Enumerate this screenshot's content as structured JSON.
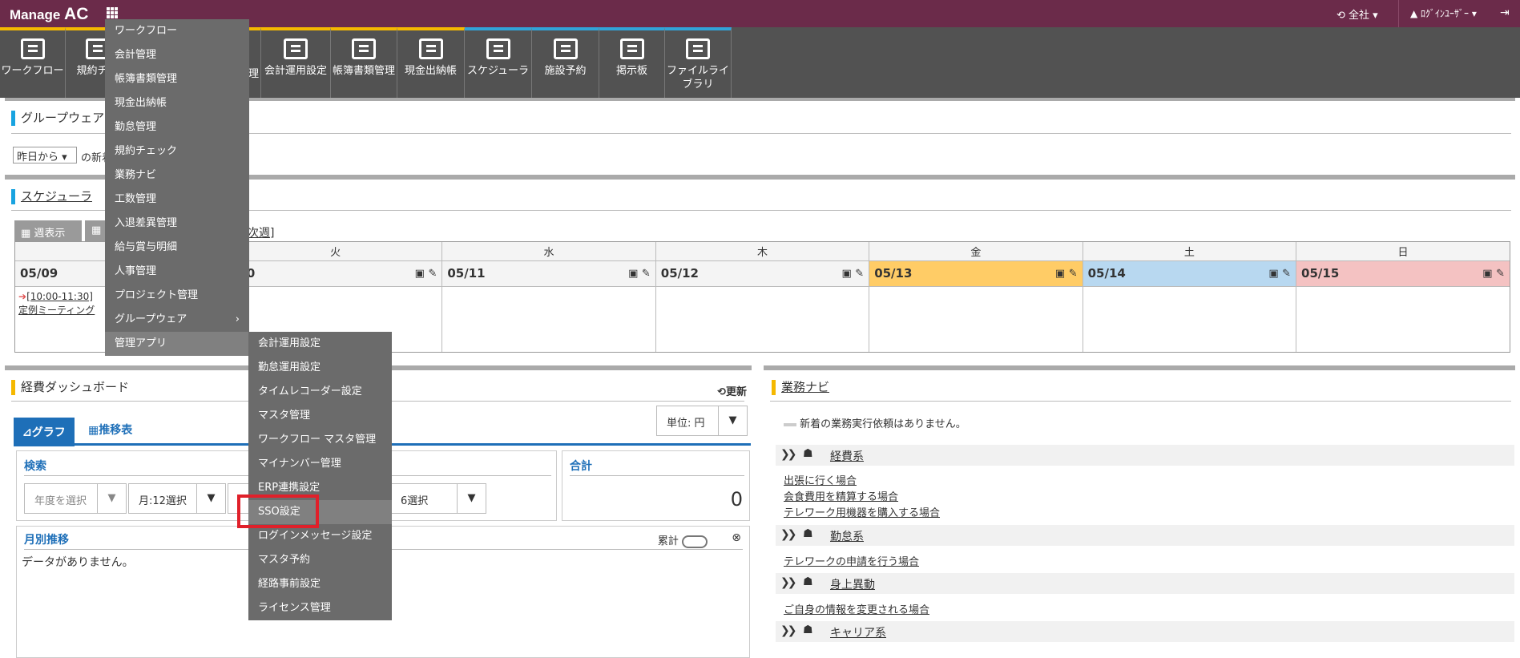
{
  "topbar": {
    "logo_prefix": "Manage",
    "logo_suffix": "AC",
    "scope": "全社",
    "user": "▲ ﾛｸﾞｲﾝﾕｰｻﾞｰ ▾"
  },
  "toolbar": [
    {
      "label": "ワークフロー"
    },
    {
      "label": "規約チェ"
    },
    {
      "label": ""
    },
    {
      "label": "理"
    },
    {
      "label": "会計運用設定"
    },
    {
      "label": "帳簿書類管理"
    },
    {
      "label": "現金出納帳"
    },
    {
      "label": "スケジューラ"
    },
    {
      "label": "施設予約"
    },
    {
      "label": "掲示板"
    },
    {
      "label": "ファイルライ\nブラリ"
    }
  ],
  "groupware": {
    "title": "グループウェア",
    "select": "昨日から",
    "suffix": "の新着"
  },
  "scheduler": {
    "title": "スケジューラ",
    "week_btn": "週表示",
    "next_week": "次週]",
    "days": [
      "",
      "火",
      "水",
      "木",
      "金",
      "土",
      "日"
    ],
    "dates": [
      "05/09",
      "/10",
      "05/11",
      "05/12",
      "05/13",
      "05/14",
      "05/15"
    ],
    "event_time": "[10:00-11:30]",
    "event_title": "定例ミーティング"
  },
  "dashboard": {
    "title": "経費ダッシュボード",
    "refresh": "更新",
    "tab_graph": "グラフ",
    "tab_table": "推移表",
    "unit": "単位: 円",
    "search": "検索",
    "year_placeholder": "年度を選択",
    "month_select": "月:12選択",
    "sel3": "6選択",
    "total_label": "合計",
    "total_value": "0",
    "monthly": "月別推移",
    "cumulative": "累計",
    "no_data": "データがありません。"
  },
  "gyomu": {
    "title": "業務ナビ",
    "no_requests": "新着の業務実行依頼はありません。",
    "cats": [
      {
        "name": "経費系",
        "links": [
          "出張に行く場合",
          "会食費用を精算する場合",
          "テレワーク用機器を購入する場合"
        ]
      },
      {
        "name": "勤怠系",
        "links": [
          "テレワークの申請を行う場合"
        ]
      },
      {
        "name": "身上異動",
        "links": [
          "ご自身の情報を変更される場合"
        ]
      },
      {
        "name": "キャリア系",
        "links": []
      }
    ]
  },
  "menu1": [
    "ワークフロー",
    "会計管理",
    "帳簿書類管理",
    "現金出納帳",
    "勤怠管理",
    "規約チェック",
    "業務ナビ",
    "工数管理",
    "入退差異管理",
    "給与賞与明細",
    "人事管理",
    "プロジェクト管理",
    "グループウェア",
    "管理アプリ"
  ],
  "menu2": [
    "会計運用設定",
    "勤怠運用設定",
    "タイムレコーダー設定",
    "マスタ管理",
    "ワークフロー マスタ管理",
    "マイナンバー管理",
    "ERP連携設定",
    "SSO設定",
    "ログインメッセージ設定",
    "マスタ予約",
    "経路事前設定",
    "ライセンス管理"
  ]
}
